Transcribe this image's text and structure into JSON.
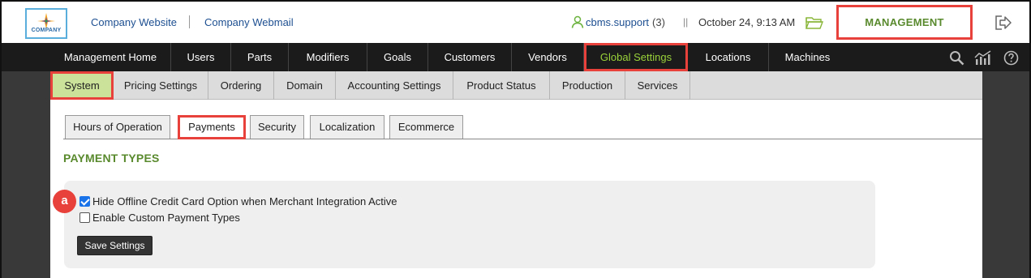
{
  "header": {
    "logo_text": "COMPANY",
    "links": [
      "Company Website",
      "Company Webmail"
    ],
    "user": "cbms.support",
    "user_count": "(3)",
    "separator": "||",
    "datetime": "October 24, 9:13 AM",
    "management_label": "MANAGEMENT",
    "icons": [
      "user-icon",
      "folder-icon",
      "logout-icon"
    ]
  },
  "main_nav": {
    "items": [
      "Management Home",
      "Users",
      "Parts",
      "Modifiers",
      "Goals",
      "Customers",
      "Vendors",
      "Global Settings",
      "Locations",
      "Machines"
    ],
    "active": "Global Settings",
    "tools": [
      "search-icon",
      "stats-icon",
      "help-icon"
    ]
  },
  "sub_nav": {
    "items": [
      "System",
      "Pricing Settings",
      "Ordering",
      "Domain",
      "Accounting Settings",
      "Product Status",
      "Production",
      "Services"
    ],
    "active": "System"
  },
  "tabs": {
    "items": [
      "Hours of Operation",
      "Payments",
      "Security",
      "Localization",
      "Ecommerce"
    ],
    "active": "Payments"
  },
  "section": {
    "title": "PAYMENT TYPES"
  },
  "options": [
    {
      "label": "Hide Offline Credit Card Option when Merchant Integration Active",
      "checked": true
    },
    {
      "label": "Enable Custom Payment Types",
      "checked": false
    }
  ],
  "callout": "a",
  "save_button": "Save Settings",
  "colors": {
    "highlight": "#e8403a",
    "accent_green": "#5a8a2e",
    "nav_bg": "#1b1b1b",
    "link_blue": "#1d4f91"
  }
}
